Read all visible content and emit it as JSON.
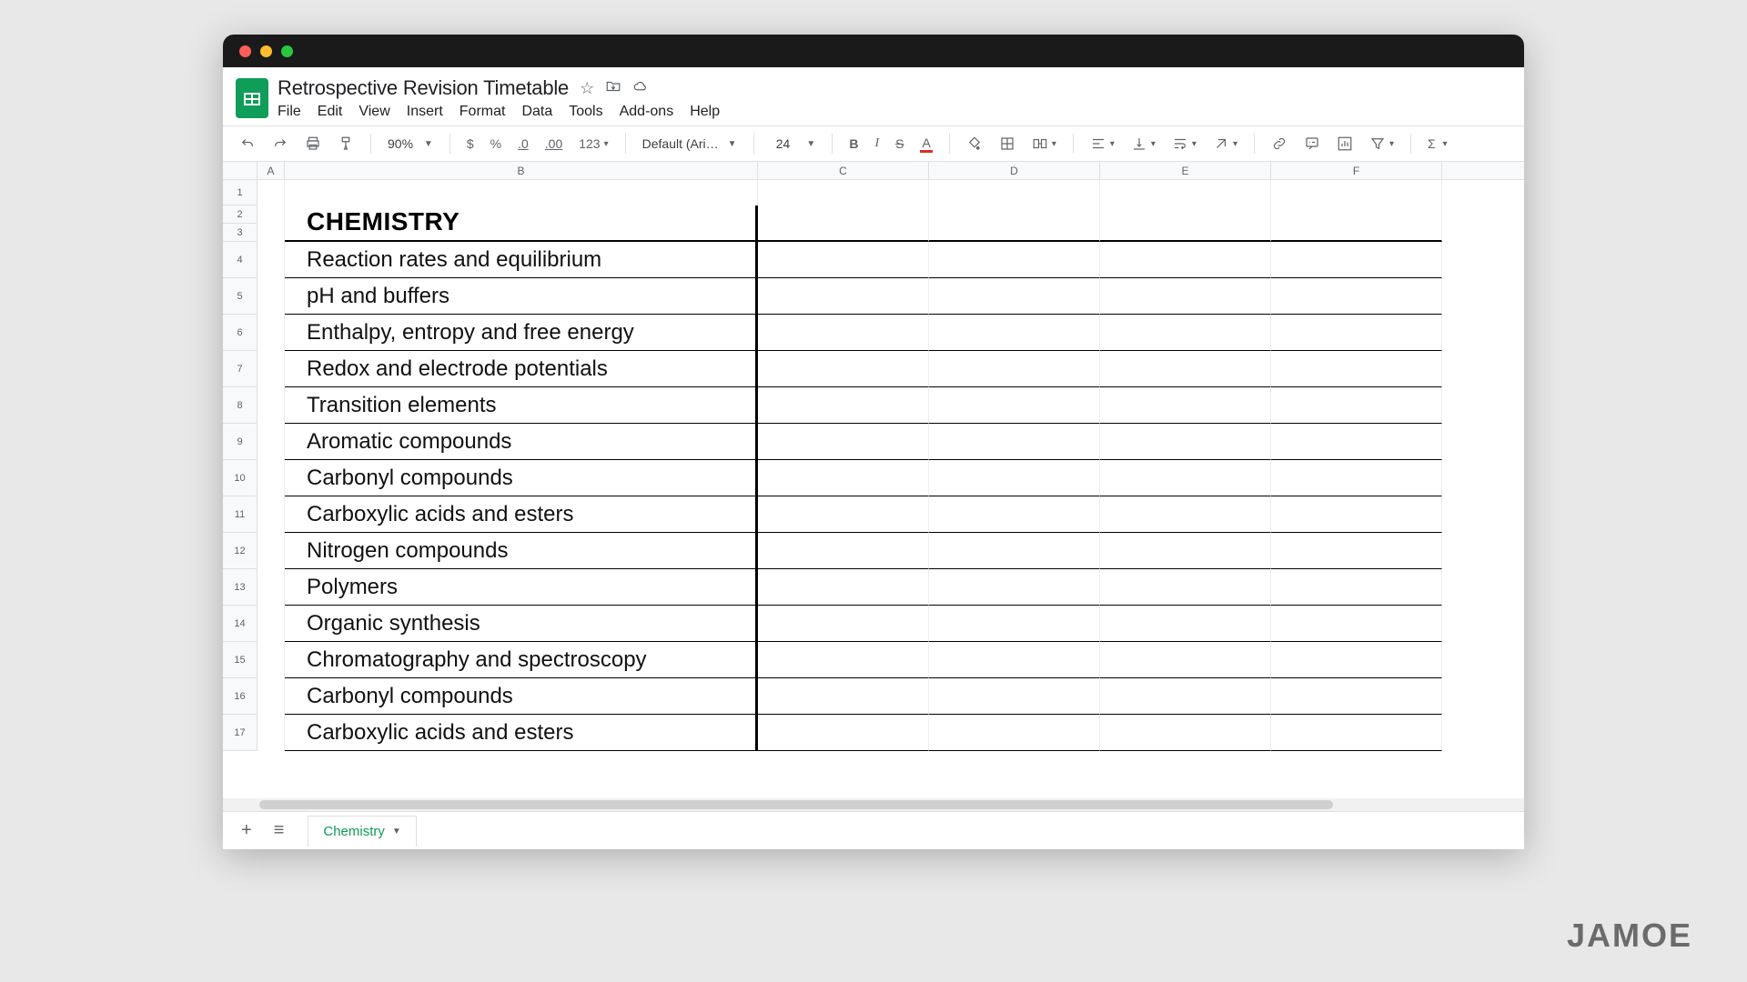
{
  "doc": {
    "title": "Retrospective Revision Timetable"
  },
  "menu": [
    "File",
    "Edit",
    "View",
    "Insert",
    "Format",
    "Data",
    "Tools",
    "Add-ons",
    "Help"
  ],
  "toolbar": {
    "zoom": "90%",
    "currency": "$",
    "percent": "%",
    "dec_dec": ".0",
    "inc_dec": ".00",
    "numfmt": "123",
    "font": "Default (Ari…",
    "font_size": "24",
    "bold": "B",
    "italic": "I",
    "strike": "S",
    "text_a": "A"
  },
  "columns": [
    "A",
    "B",
    "C",
    "D",
    "E",
    "F"
  ],
  "row_heights": {
    "r1": 28,
    "header": 20,
    "topic": 40
  },
  "heading": "CHEMISTRY",
  "topics": [
    "Reaction rates and equilibrium",
    "pH and buffers",
    "Enthalpy, entropy and free energy",
    "Redox and electrode potentials",
    "Transition elements",
    "Aromatic compounds",
    "Carbonyl compounds",
    "Carboxylic acids and esters",
    "Nitrogen compounds",
    "Polymers",
    "Organic synthesis",
    "Chromatography and spectroscopy",
    "Carbonyl compounds",
    "Carboxylic acids and esters"
  ],
  "sheet_tab": "Chemistry",
  "watermark": "JAMOE"
}
